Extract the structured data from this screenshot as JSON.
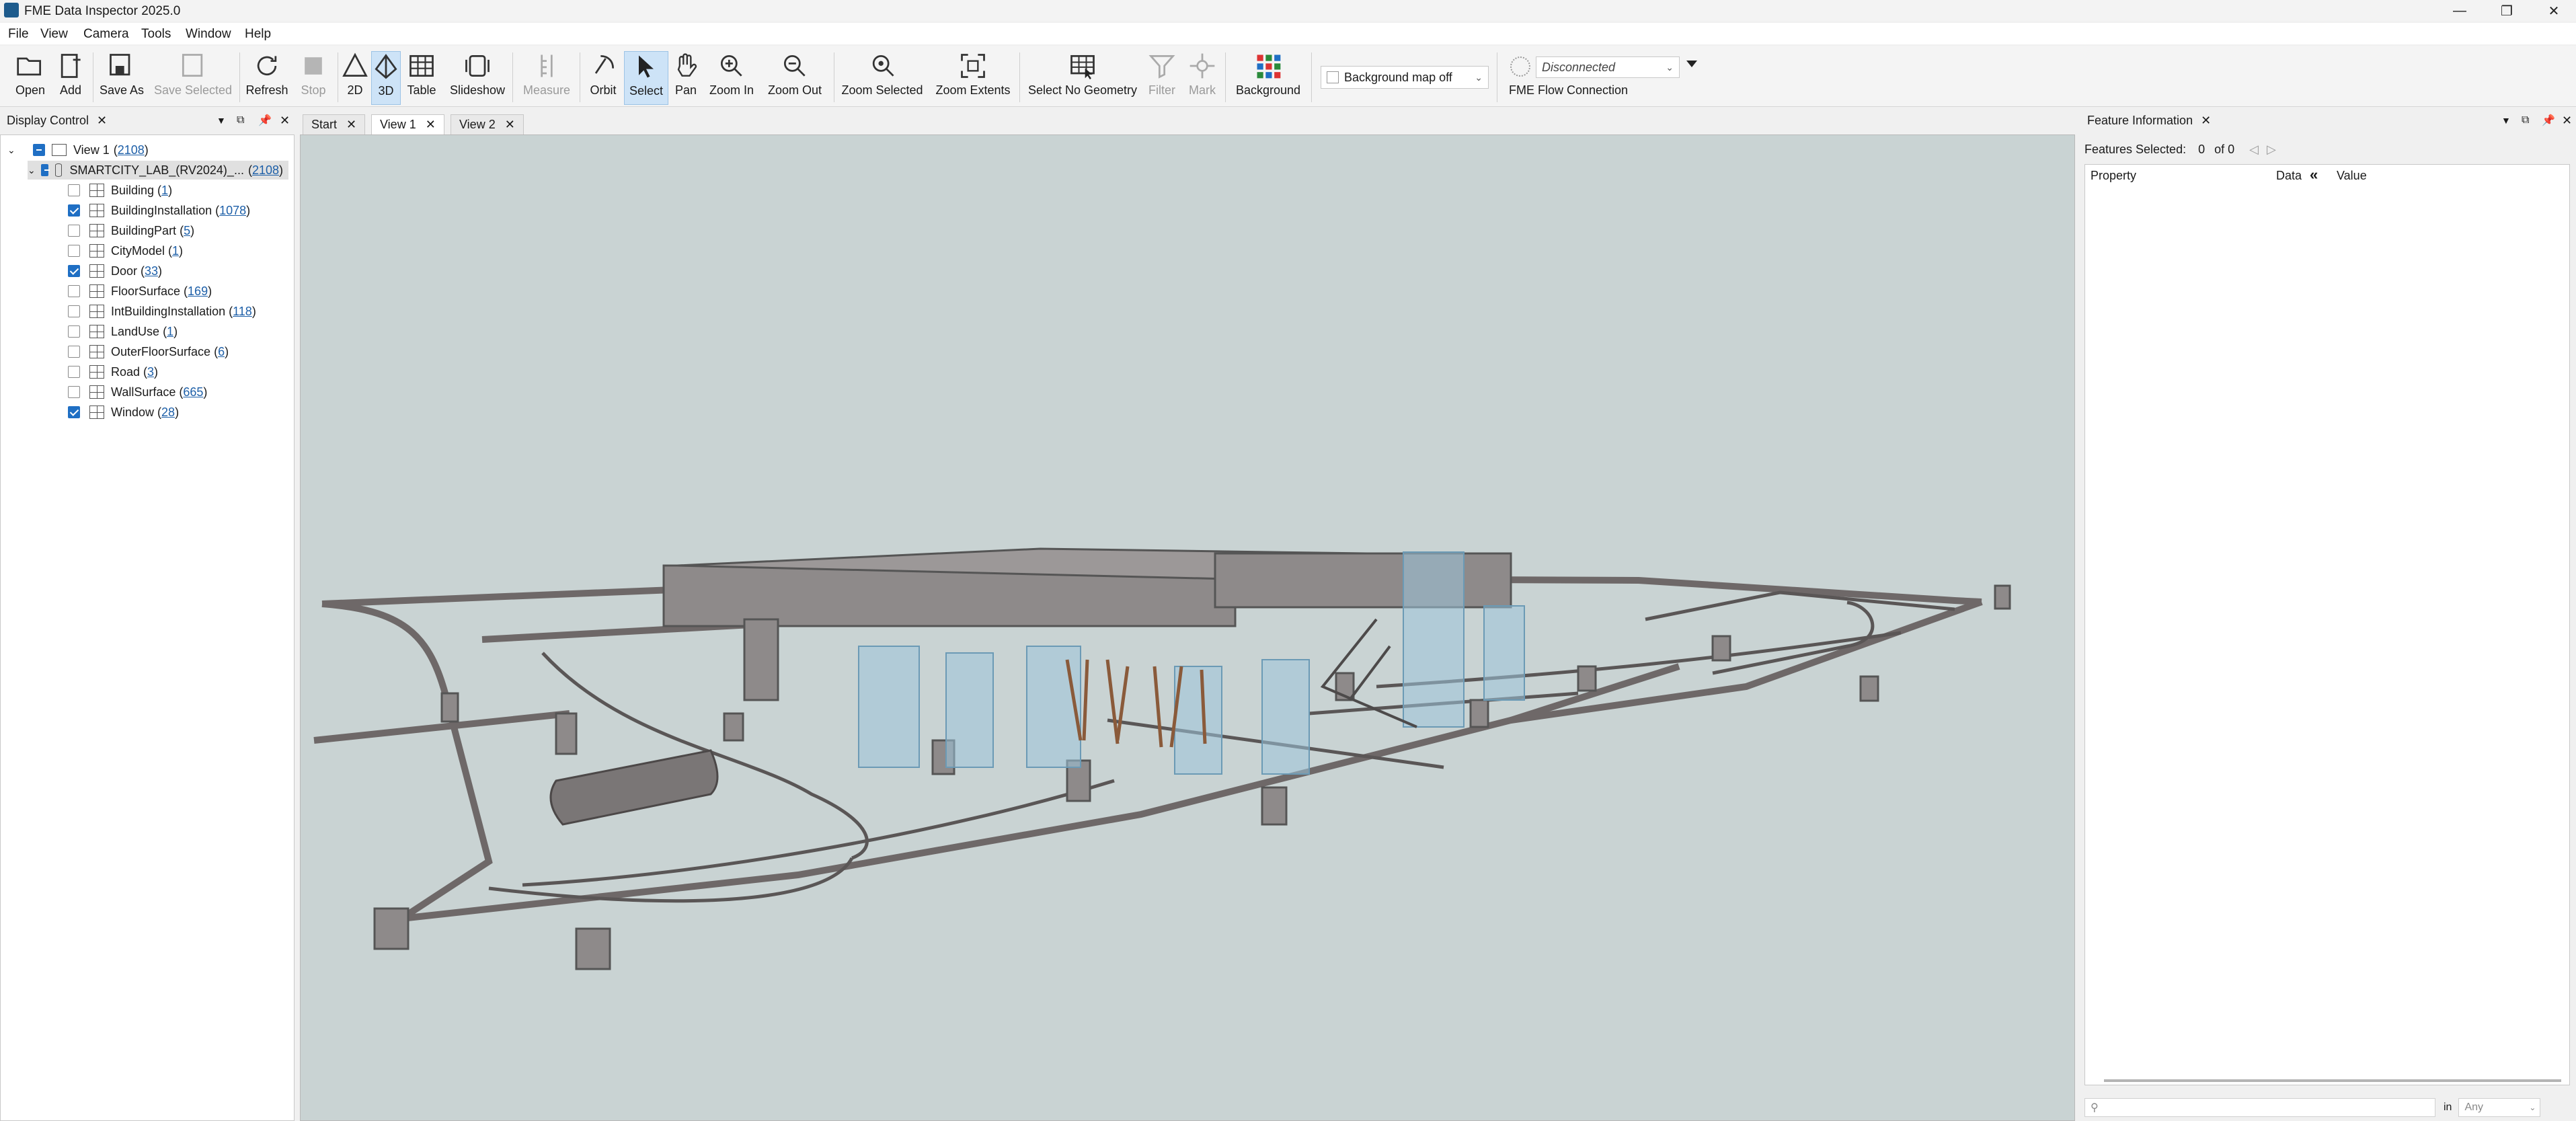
{
  "window": {
    "title": "FME Data Inspector 2025.0"
  },
  "menu": [
    "File",
    "View",
    "Camera",
    "Tools",
    "Window",
    "Help"
  ],
  "toolbar": {
    "open": "Open",
    "add": "Add",
    "save_as": "Save As",
    "save_selected": "Save Selected",
    "refresh": "Refresh",
    "stop": "Stop",
    "mode_2d": "2D",
    "mode_3d": "3D",
    "table": "Table",
    "slideshow": "Slideshow",
    "measure": "Measure",
    "orbit": "Orbit",
    "select": "Select",
    "pan": "Pan",
    "zoom_in": "Zoom In",
    "zoom_out": "Zoom Out",
    "zoom_selected": "Zoom Selected",
    "zoom_extents": "Zoom Extents",
    "select_no_geometry": "Select No Geometry",
    "filter": "Filter",
    "mark": "Mark",
    "background": "Background",
    "background_map": "Background map off",
    "connection_status": "Disconnected",
    "flow_connection": "FME Flow Connection"
  },
  "display_control": {
    "title": "Display Control",
    "view": {
      "label": "View 1",
      "count": "2108"
    },
    "dataset": {
      "label": "SMARTCITY_LAB_(RV2024)_...",
      "count": "2108"
    },
    "layers": [
      {
        "name": "Building",
        "count": "1",
        "checked": false
      },
      {
        "name": "BuildingInstallation",
        "count": "1078",
        "checked": true
      },
      {
        "name": "BuildingPart",
        "count": "5",
        "checked": false
      },
      {
        "name": "CityModel",
        "count": "1",
        "checked": false
      },
      {
        "name": "Door",
        "count": "33",
        "checked": true
      },
      {
        "name": "FloorSurface",
        "count": "169",
        "checked": false
      },
      {
        "name": "IntBuildingInstallation",
        "count": "118",
        "checked": false
      },
      {
        "name": "LandUse",
        "count": "1",
        "checked": false
      },
      {
        "name": "OuterFloorSurface",
        "count": "6",
        "checked": false
      },
      {
        "name": "Road",
        "count": "3",
        "checked": false
      },
      {
        "name": "WallSurface",
        "count": "665",
        "checked": false
      },
      {
        "name": "Window",
        "count": "28",
        "checked": true
      }
    ]
  },
  "tabs": [
    "Start",
    "View 1",
    "View 2"
  ],
  "feature_info": {
    "title": "Feature Information",
    "features_selected_label": "Features Selected:",
    "selected_count": "0",
    "of_total": "of 0",
    "col_property": "Property",
    "col_data": "Data",
    "col_value": "Value",
    "search_in": "in",
    "search_scope": "Any"
  },
  "colors": {
    "viewport_bg": "#c9d3d3",
    "accent": "#1f6fc4",
    "link": "#1d5fa8"
  }
}
